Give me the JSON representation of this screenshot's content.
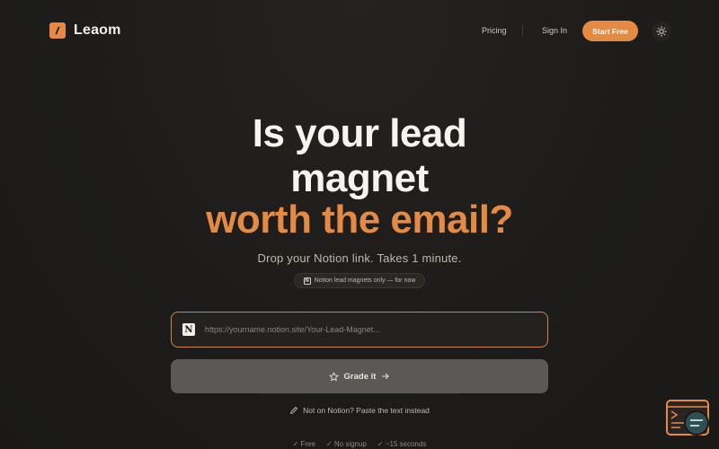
{
  "header": {
    "brand": "Leaom",
    "nav": {
      "pricing": "Pricing",
      "sign_in": "Sign In",
      "start_free": "Start Free"
    },
    "icons": {
      "logo": "slash-logo-icon",
      "theme": "sun-icon"
    }
  },
  "hero": {
    "line1": "Is your lead",
    "line2": "magnet",
    "line3": "worth the email?",
    "subtitle": "Drop your Notion link. Takes 1 minute.",
    "badge": "Notion lead magnets only — for now"
  },
  "form": {
    "url_placeholder": "https://yourname.notion.site/Your-Lead-Magnet...",
    "url_value": "",
    "grade_label": "Grade it",
    "paste_link": "Not on Notion? Paste the text instead"
  },
  "footer": {
    "checks": [
      "✓ Free",
      "✓ No signup",
      "✓ ~15 seconds"
    ]
  },
  "colors": {
    "accent": "#e58a45",
    "background": "#1d1c1a",
    "button_disabled": "#5b5855",
    "text_primary": "#f7f4ef",
    "text_muted": "#bdb8b0"
  }
}
